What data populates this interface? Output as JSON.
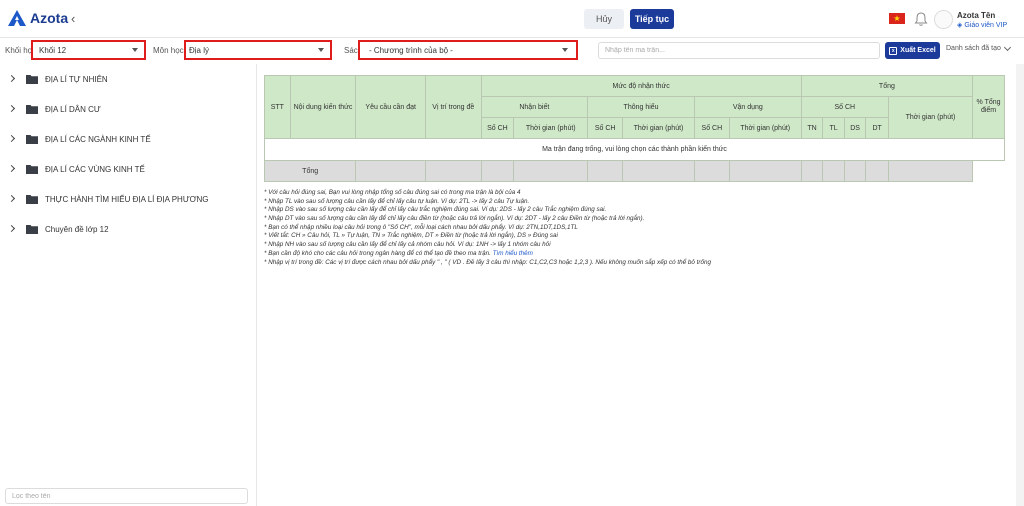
{
  "header": {
    "logo_text": "Azota",
    "cancel_label": "Hủy",
    "next_label": "Tiếp tục",
    "user_name": "Azota Tên",
    "user_role": "Giáo viên VIP",
    "flag_star": "★"
  },
  "filters": {
    "grade_label": "Khối học",
    "grade_value": "Khối 12",
    "subject_label": "Môn học",
    "subject_value": "Địa lý",
    "book_label": "Sách",
    "book_value": "- Chương trình của bộ -",
    "search_placeholder": "Nhập tên ma trận...",
    "export_label": "Xuất Excel",
    "export_icon_glyph": "x",
    "list_label": "Danh sách đã tạo"
  },
  "sidebar": {
    "items": [
      {
        "label": "ĐỊA LÍ TỰ NHIÊN"
      },
      {
        "label": "ĐỊA LÍ DÂN CƯ"
      },
      {
        "label": "ĐỊA LÍ CÁC NGÀNH KINH TẾ"
      },
      {
        "label": "ĐỊA LÍ CÁC VÙNG KINH TẾ"
      },
      {
        "label": "THỰC HÀNH TÌM HIỂU ĐỊA LÍ ĐỊA PHƯƠNG"
      },
      {
        "label": "Chuyên đề lớp 12"
      }
    ],
    "filter_placeholder": "Lọc theo tên"
  },
  "table": {
    "h_stt": "STT",
    "h_content": "Nội dung kiến thức",
    "h_requirement": "Yêu cầu cần đạt",
    "h_position": "Vị trí trong đề",
    "h_level": "Mức độ nhận thức",
    "h_total": "Tổng",
    "h_percent": "% Tổng điểm",
    "h_recognize": "Nhận biết",
    "h_understand": "Thông hiểu",
    "h_apply": "Vận dụng",
    "h_count": "Số CH",
    "h_time": "Thời gian (phút)",
    "h_total_time": "Thời gian (phút)",
    "h_tn": "TN",
    "h_tl": "TL",
    "h_ds": "DS",
    "h_dt": "DT",
    "empty_message": "Ma trận đang trống, vui lòng chọn các thành phần kiến thức",
    "total_row_label": "Tổng"
  },
  "notes": [
    "* Với câu hỏi đúng sai, Bạn vui lòng nhập tổng số câu đúng sai có trong ma trận là bội của 4",
    "* Nhập TL vào sau số lượng câu cần lấy để chỉ lấy câu tự luận. Ví dụ: 2TL -> lấy 2 câu Tự luận.",
    "* Nhập DS vào sau số lượng câu cần lấy để chỉ lấy câu trắc nghiệm đúng sai. Ví dụ: 2DS - lấy 2 câu Trắc nghiệm đúng sai.",
    "* Nhập DT vào sau số lượng câu cần lấy để chỉ lấy câu điền từ (hoặc câu trả lời ngắn). Ví dụ: 2DT - lấy 2 câu Điền từ (hoặc trả lời ngắn).",
    "* Bạn có thể nhập nhiều loại câu hỏi trong ô \"Số CH\", mỗi loại cách nhau bởi dấu phẩy. Ví dụ: 2TN,1DT,1DS,1TL",
    "* Viết tắt: CH » Câu hỏi, TL » Tự luận, TN » Trắc nghiệm, DT » Điền từ (hoặc trả lời ngắn), DS » Đúng sai",
    "* Nhập NH vào sau số lượng câu cần lấy để chỉ lấy cả nhóm câu hỏi. Ví dụ: 1NH -> lấy 1 nhóm câu hỏi"
  ],
  "note_link_prefix": "* Bạn cần độ khó cho các câu hỏi trong ngân hàng để có thể tạo đề theo ma trận.",
  "note_link_text": "Tìm hiểu thêm",
  "note_last": "* Nhập vị trí trong đề: Các vị trí được cách nhau bởi dấu phẩy \" , \" ( VD . Đề lấy 3 câu thì nhập: C1,C2,C3 hoặc 1,2,3 ). Nếu không muốn sắp xếp có thể bỏ trống"
}
